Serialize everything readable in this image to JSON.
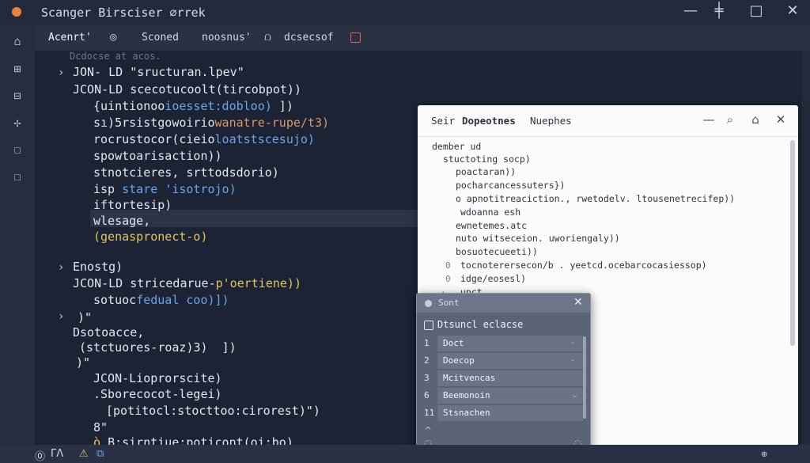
{
  "window": {
    "title": "Scanger Birsciser ∅rrek",
    "title_icon": "drop-icon",
    "controls": [
      "—",
      "╪",
      "□",
      "✕"
    ]
  },
  "activity_bar": {
    "icons": [
      "home-icon",
      "layout-grid-icon",
      "bus-icon",
      "move-icon",
      "square-icon",
      "square-outline-icon"
    ],
    "glyphs": [
      "⌂",
      "⊞",
      "⊟",
      "✢",
      "☐",
      "☐"
    ]
  },
  "tabs": {
    "active": "Acenrt'",
    "active_icon_glyph": "◎",
    "item2": "Sconed",
    "item3": "noosnus'",
    "item3_icon_glyph": "⩍",
    "item4": "dcsecsof"
  },
  "editor": {
    "comment": "Dcdocse at acos.",
    "lines": {
      "l1": "JON- LD \"sructuran.lpev\"",
      "l2": "JCON-LD scecotucoolt(tircobpot))",
      "l3a": "{uintionoo",
      "l3b": "ioesset:dobloo)",
      "l3c": " ])",
      "l4a": "sı)5rsistgowoirio",
      "l4b": "wanatre-rupe/t3)",
      "l5a": "rocrustocor(cieio",
      "l5b": "loatstscesujo)",
      "l6": "spowtoarisaction))",
      "l7": "stnotcieres, srttodsdorio)",
      "l8a": "isp",
      "l8b": "stare 'isotrojo)",
      "l9": "iftortesip)",
      "l10": "wlesage,",
      "l11": "(genaspronect-o)",
      "l12": "Enostg)",
      "l13a": "JCON-LD stricedarue-",
      "l13b": "p'oertiene))",
      "l14a": "sotuoc",
      "l14b": "fedual coo)])",
      "l15": "Dsotoacce,",
      "l16": "(stctuores-roaz)3)  ])",
      "l17": "JCON-Lioprorscite)",
      "l18": ".Sborecocot-legei)",
      "l19": "[potitocl:stocttoo:cirorest)\")",
      "l20": "B:sirntiue:poticont(oi:bo)"
    }
  },
  "panel": {
    "tab1": "Seir",
    "tab2": "Dopeotnes",
    "tab3": "Nuephes",
    "lines": [
      "dember ud",
      "stuctoting socp)",
      "poactaran))",
      "pocharcancessuters})",
      "o apnotitreaciction., rwetodelv. ltousenetrecifep))",
      "wdoanna esh",
      "ewnetemes.atc",
      "nuto witseceion. uworiengaly))",
      "bosuotecueeti))",
      "tocnoterersecon/b . yeetcd.ocebarcocasiessop)",
      "idge/eosesl)",
      "upct"
    ]
  },
  "popup": {
    "title": "Sont",
    "checkbox_label": "Dtsuncl eclacse",
    "rows": [
      {
        "num": "1",
        "label": "Doct"
      },
      {
        "num": "2",
        "label": "Doecop"
      },
      {
        "num": "3",
        "label": "Mcitvencas"
      },
      {
        "num": "6",
        "label": "Beemonoin"
      },
      {
        "num": "11",
        "label": "Stsnachen"
      }
    ]
  },
  "statusbar": {
    "items": [
      "⓪",
      "ΓΛ",
      "⚠",
      "⧉"
    ],
    "right": "⊕"
  }
}
